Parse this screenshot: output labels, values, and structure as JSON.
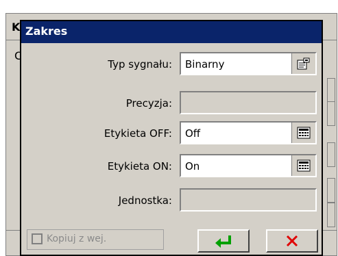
{
  "background_window": {
    "title_fragment": "Ka",
    "content_fragment": "C"
  },
  "dialog": {
    "title": "Zakres",
    "rows": [
      {
        "label": "Typ sygnału:",
        "value": "Binarny",
        "button_icon": "properties-icon",
        "enabled": true
      },
      {
        "label": "Precyzja:",
        "value": "",
        "button_icon": "",
        "enabled": false
      },
      {
        "label": "Etykieta OFF:",
        "value": "Off",
        "button_icon": "keyboard-icon",
        "enabled": true
      },
      {
        "label": "Etykieta ON:",
        "value": "On",
        "button_icon": "keyboard-icon",
        "enabled": true
      },
      {
        "label": "Jednostka:",
        "value": "",
        "button_icon": "",
        "enabled": false
      }
    ],
    "checkbox": {
      "label": "Kopiuj z wej.",
      "checked": false,
      "enabled": false
    },
    "buttons": {
      "ok_icon": "enter-icon",
      "cancel_icon": "close-icon"
    }
  },
  "colors": {
    "titlebar": "#0a246a",
    "ok_green": "#00a000",
    "cancel_red": "#e00000",
    "face": "#d4d0c8"
  }
}
